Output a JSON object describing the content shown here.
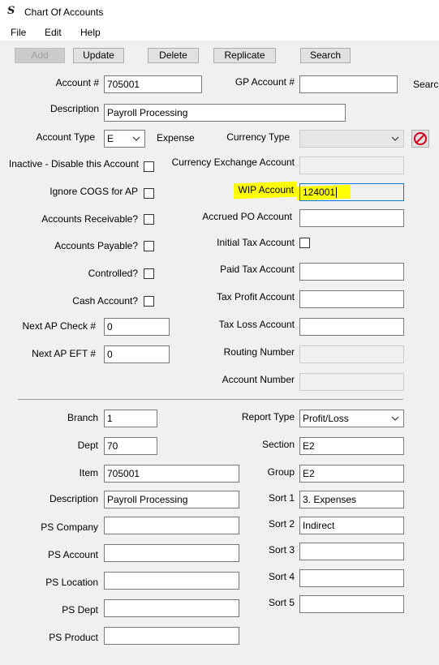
{
  "window": {
    "title": "Chart Of Accounts",
    "app_icon": "S"
  },
  "menu": [
    "File",
    "Edit",
    "Help"
  ],
  "toolbar": {
    "add": "Add",
    "update": "Update",
    "delete": "Delete",
    "replicate": "Replicate",
    "search": "Search"
  },
  "labels": {
    "account_num": "Account #",
    "gp_account": "GP Account #",
    "search_cut": "Search",
    "description": "Description",
    "account_type": "Account Type",
    "currency_type": "Currency Type",
    "inactive": "Inactive - Disable this Account",
    "currency_exchange": "Currency Exchange Account",
    "ignore_cogs": "Ignore COGS for AP",
    "wip_account": "WIP Account",
    "accounts_receivable": "Accounts Receivable?",
    "accrued_po": "Accrued PO Account",
    "accounts_payable": "Accounts Payable?",
    "initial_tax": "Initial Tax Account",
    "controlled": "Controlled?",
    "paid_tax": "Paid Tax Account",
    "cash_account": "Cash Account?",
    "tax_profit": "Tax Profit Account",
    "next_ap_check": "Next AP Check #",
    "tax_loss": "Tax Loss Account",
    "next_ap_eft": "Next AP EFT #",
    "routing_number": "Routing Number",
    "account_number": "Account Number",
    "branch": "Branch",
    "report_type": "Report Type",
    "dept": "Dept",
    "section": "Section",
    "item": "Item",
    "group": "Group",
    "description2": "Description",
    "sort1": "Sort 1",
    "ps_company": "PS Company",
    "sort2": "Sort 2",
    "ps_account": "PS Account",
    "sort3": "Sort 3",
    "ps_location": "PS Location",
    "sort4": "Sort 4",
    "ps_dept": "PS Dept",
    "sort5": "Sort 5",
    "ps_product": "PS Product"
  },
  "values": {
    "account_num": "705001",
    "gp_account": "",
    "description": "Payroll Processing",
    "account_type": "E",
    "account_type_desc": "Expense",
    "currency_type": "",
    "currency_exchange": "",
    "wip_account": "124001",
    "accrued_po": "",
    "paid_tax": "",
    "tax_profit": "",
    "next_ap_check": "0",
    "tax_loss": "",
    "next_ap_eft": "0",
    "routing_number": "",
    "account_number": "",
    "branch": "1",
    "report_type": "Profit/Loss",
    "dept": "70",
    "section": "E2",
    "item": "705001",
    "group": "E2",
    "description2": "Payroll Processing",
    "sort1": "3. Expenses",
    "ps_company": "",
    "sort2": "Indirect",
    "ps_account": "",
    "sort3": "",
    "ps_location": "",
    "sort4": "",
    "ps_dept": "",
    "sort5": "",
    "ps_product": ""
  },
  "checkboxes": {
    "inactive": false,
    "ignore_cogs": false,
    "accounts_receivable": false,
    "accounts_payable": false,
    "initial_tax": false,
    "controlled": false,
    "cash_account": false
  },
  "colors": {
    "highlight": "#ffff00",
    "focus_border": "#0078d7",
    "no_icon": "#d9001b"
  }
}
